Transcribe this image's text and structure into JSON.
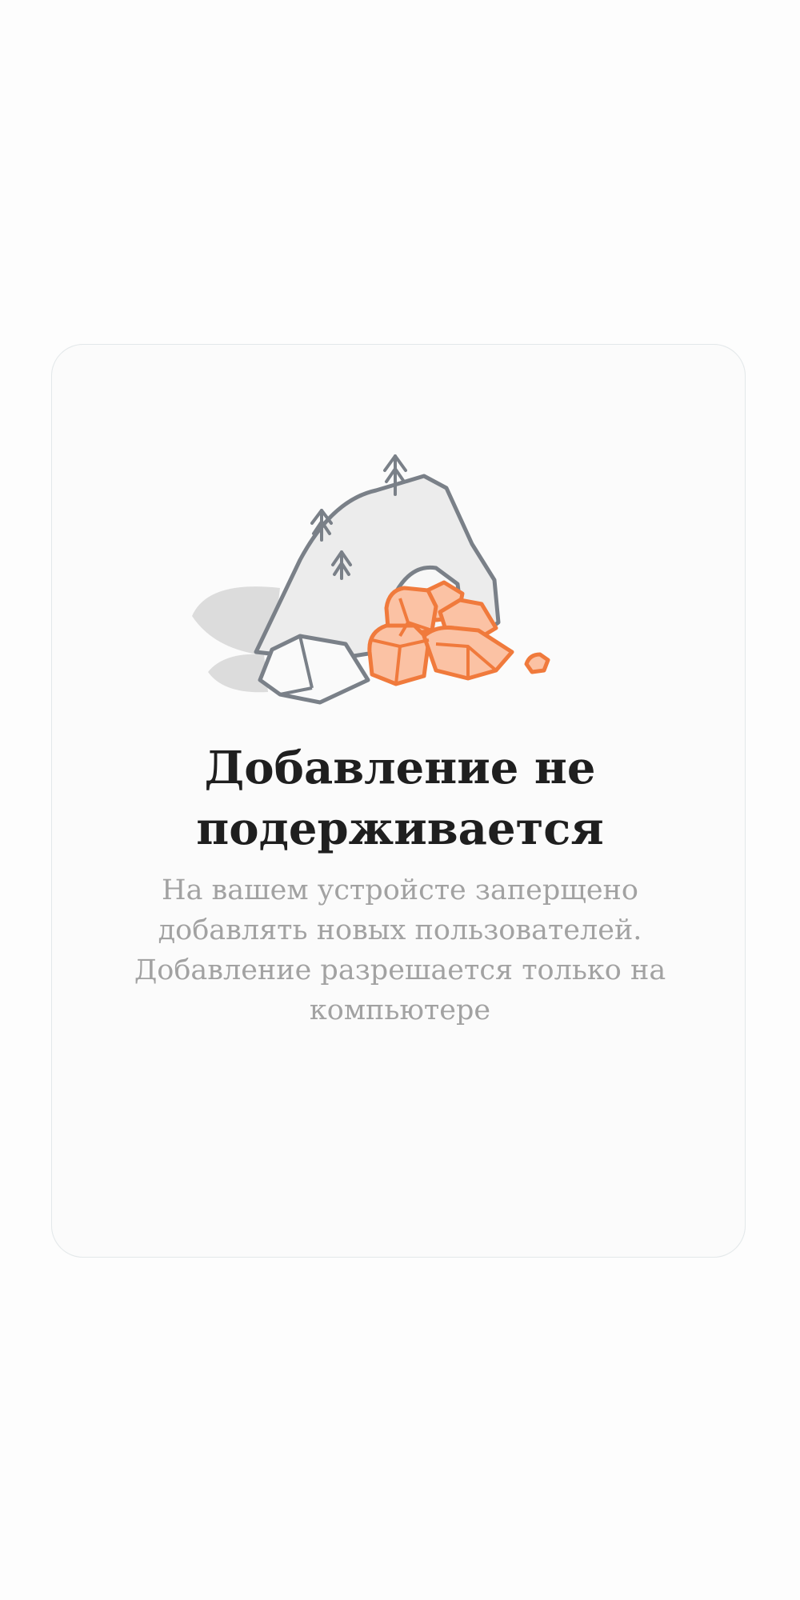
{
  "dialog": {
    "illustration_icon": "rocks-and-cave-icon",
    "title": "Добавление не подерживается",
    "message": "На вашем устройсте заперщено добавлять новых пользователей. Добавление разрешается только на компьютере"
  },
  "colors": {
    "accent": "#f07a3c",
    "accent_fill": "#fbc2a4",
    "outline": "#7a8088",
    "title": "#1f1f1f",
    "message": "#a2a2a2",
    "card_background": "#fbfbfb"
  }
}
